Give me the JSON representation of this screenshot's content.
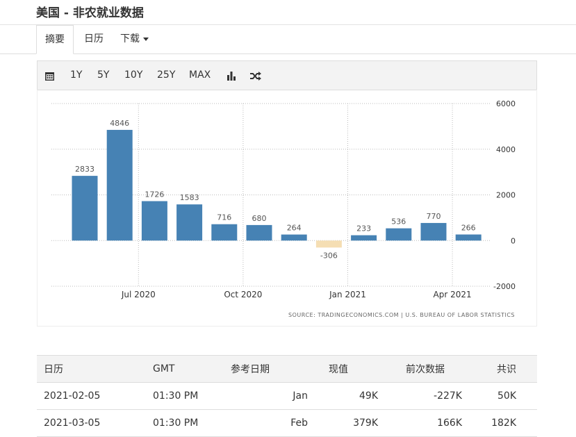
{
  "page": {
    "title": "美国 - 非农就业数据"
  },
  "tabs": [
    {
      "label": "摘要",
      "active": true
    },
    {
      "label": "日历",
      "active": false
    },
    {
      "label": "下载",
      "active": false
    }
  ],
  "toolbar": {
    "ranges": [
      "1Y",
      "5Y",
      "10Y",
      "25Y",
      "MAX"
    ],
    "icons": [
      "calendar-icon",
      "bar-chart-icon",
      "shuffle-icon"
    ]
  },
  "chart_data": {
    "type": "bar",
    "categories": [
      "2020-05",
      "2020-06",
      "2020-07",
      "2020-08",
      "2020-09",
      "2020-10",
      "2020-11",
      "2020-12",
      "2021-01",
      "2021-02",
      "2021-03",
      "2021-04"
    ],
    "values": [
      2833,
      4846,
      1726,
      1583,
      716,
      680,
      264,
      -306,
      233,
      536,
      770,
      266
    ],
    "data_labels": [
      "2833",
      "4846",
      "1726",
      "1583",
      "716",
      "680",
      "264",
      "-306",
      "233",
      "536",
      "770",
      "266"
    ],
    "x_ticks": [
      "Jul 2020",
      "Oct 2020",
      "Jan 2021",
      "Apr 2021"
    ],
    "y_ticks": [
      "6000",
      "4000",
      "2000",
      "0",
      "-2000"
    ],
    "ylim": [
      -2000,
      6000
    ],
    "positive_color": "#4682b4",
    "negative_color": "#f5deb3",
    "source": "SOURCE: TRADINGECONOMICS.COM | U.S. BUREAU OF LABOR STATISTICS",
    "grid": true
  },
  "table": {
    "headers": [
      "日历",
      "GMT",
      "参考日期",
      "现值",
      "前次数据",
      "共识"
    ],
    "rows": [
      [
        "2021-02-05",
        "01:30 PM",
        "Jan",
        "49K",
        "-227K",
        "50K"
      ],
      [
        "2021-03-05",
        "01:30 PM",
        "Feb",
        "379K",
        "166K",
        "182K"
      ]
    ]
  }
}
